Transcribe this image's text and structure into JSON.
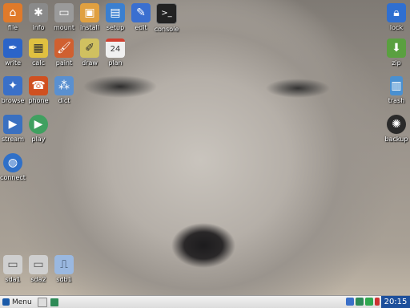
{
  "desktop": {
    "icons": [
      {
        "label": "file",
        "icon": "home-folder-icon",
        "color": "#e07a2a"
      },
      {
        "label": "info",
        "icon": "info-network-icon",
        "color": "#8a8a8a"
      },
      {
        "label": "mount",
        "icon": "drive-icon",
        "color": "#9a9a9a"
      },
      {
        "label": "install",
        "icon": "package-install-icon",
        "color": "#e0a040"
      },
      {
        "label": "setup",
        "icon": "monitor-setup-icon",
        "color": "#3a7fd0"
      },
      {
        "label": "edit",
        "icon": "pencil-edit-icon",
        "color": "#3a6fd0"
      },
      {
        "label": "console",
        "icon": "terminal-icon",
        "color": "#222222"
      },
      {
        "label": "lock",
        "icon": "padlock-icon",
        "color": "#2f6fd0"
      },
      {
        "label": "write",
        "icon": "writer-pen-icon",
        "color": "#2b64c8"
      },
      {
        "label": "calc",
        "icon": "calculator-icon",
        "color": "#e0c040"
      },
      {
        "label": "paint",
        "icon": "paintbrush-icon",
        "color": "#d06030"
      },
      {
        "label": "draw",
        "icon": "draw-icon",
        "color": "#d0c060"
      },
      {
        "label": "plan",
        "icon": "calendar-icon",
        "color": "#f0f0f0"
      },
      {
        "label": "zip",
        "icon": "archive-icon",
        "color": "#5aa040"
      },
      {
        "label": "browse",
        "icon": "browser-star-icon",
        "color": "#3a70c8"
      },
      {
        "label": "phone",
        "icon": "phone-icon",
        "color": "#d05020"
      },
      {
        "label": "dict",
        "icon": "dictionary-icon",
        "color": "#5a90d0"
      },
      {
        "label": "trash",
        "icon": "trash-can-icon",
        "color": "#4a90d0"
      },
      {
        "label": "stream",
        "icon": "stream-play-icon",
        "color": "#3a70c0"
      },
      {
        "label": "play",
        "icon": "play-button-icon",
        "color": "#40a060"
      },
      {
        "label": "backup",
        "icon": "backup-lifebuoy-icon",
        "color": "#2a2a2a"
      },
      {
        "label": "connect",
        "icon": "globe-connect-icon",
        "color": "#2f70c8"
      },
      {
        "label": "sda1",
        "icon": "disk-drive-icon",
        "color": "#cfcfcf"
      },
      {
        "label": "sda2",
        "icon": "disk-drive-icon",
        "color": "#cfcfcf"
      },
      {
        "label": "sdb1",
        "icon": "usb-stick-icon",
        "color": "#9ab8e0"
      }
    ]
  },
  "taskbar": {
    "menu_label": "Menu",
    "clock": "20:15",
    "tray_colors": [
      "#3a6fc8",
      "#2e8b57",
      "#2fa84f",
      "#cc3333"
    ]
  }
}
